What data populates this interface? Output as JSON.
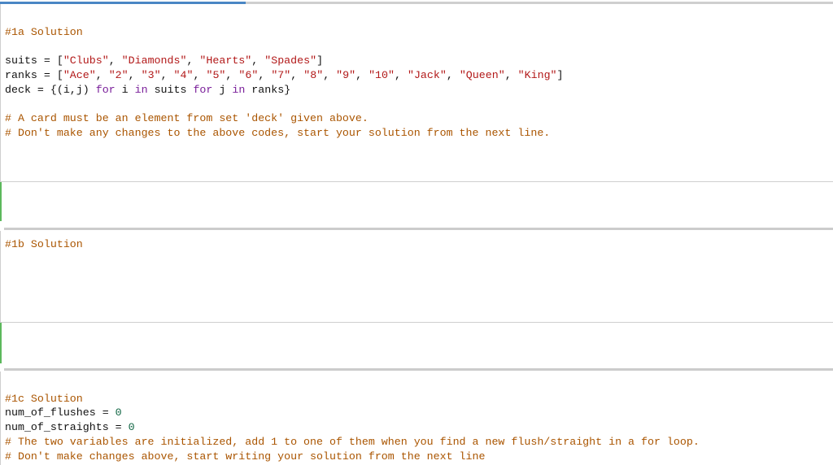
{
  "execution_progress": 0.295,
  "cells": [
    {
      "id": "1a",
      "heading": "#1a Solution",
      "suits_var": "suits",
      "suits_values": [
        "\"Clubs\"",
        "\"Diamonds\"",
        "\"Hearts\"",
        "\"Spades\""
      ],
      "ranks_var": "ranks",
      "ranks_values": [
        "\"Ace\"",
        "\"2\"",
        "\"3\"",
        "\"4\"",
        "\"5\"",
        "\"6\"",
        "\"7\"",
        "\"8\"",
        "\"9\"",
        "\"10\"",
        "\"Jack\"",
        "\"Queen\"",
        "\"King\""
      ],
      "deck_line": {
        "lhs": "deck = {(i,j) ",
        "kw_for1": "for",
        "var_i": " i ",
        "kw_in1": "in",
        "mid": " suits ",
        "kw_for2": "for",
        "var_j": " j ",
        "kw_in2": "in",
        "tail": " ranks}"
      },
      "comments": [
        "# A card must be an element from set 'deck' given above.",
        "# Don't make any changes to the above codes, start your solution from the next line."
      ]
    },
    {
      "id": "1b",
      "heading": "#1b Solution"
    },
    {
      "id": "1c",
      "heading": "#1c Solution",
      "assign1_lhs": "num_of_flushes = ",
      "assign1_val": "0",
      "assign2_lhs": "num_of_straights = ",
      "assign2_val": "0",
      "comments": [
        "# The two variables are initialized, add 1 to one of them when you find a new flush/straight in a for loop.",
        "# Don't make changes above, start writing your solution from the next line"
      ]
    }
  ]
}
